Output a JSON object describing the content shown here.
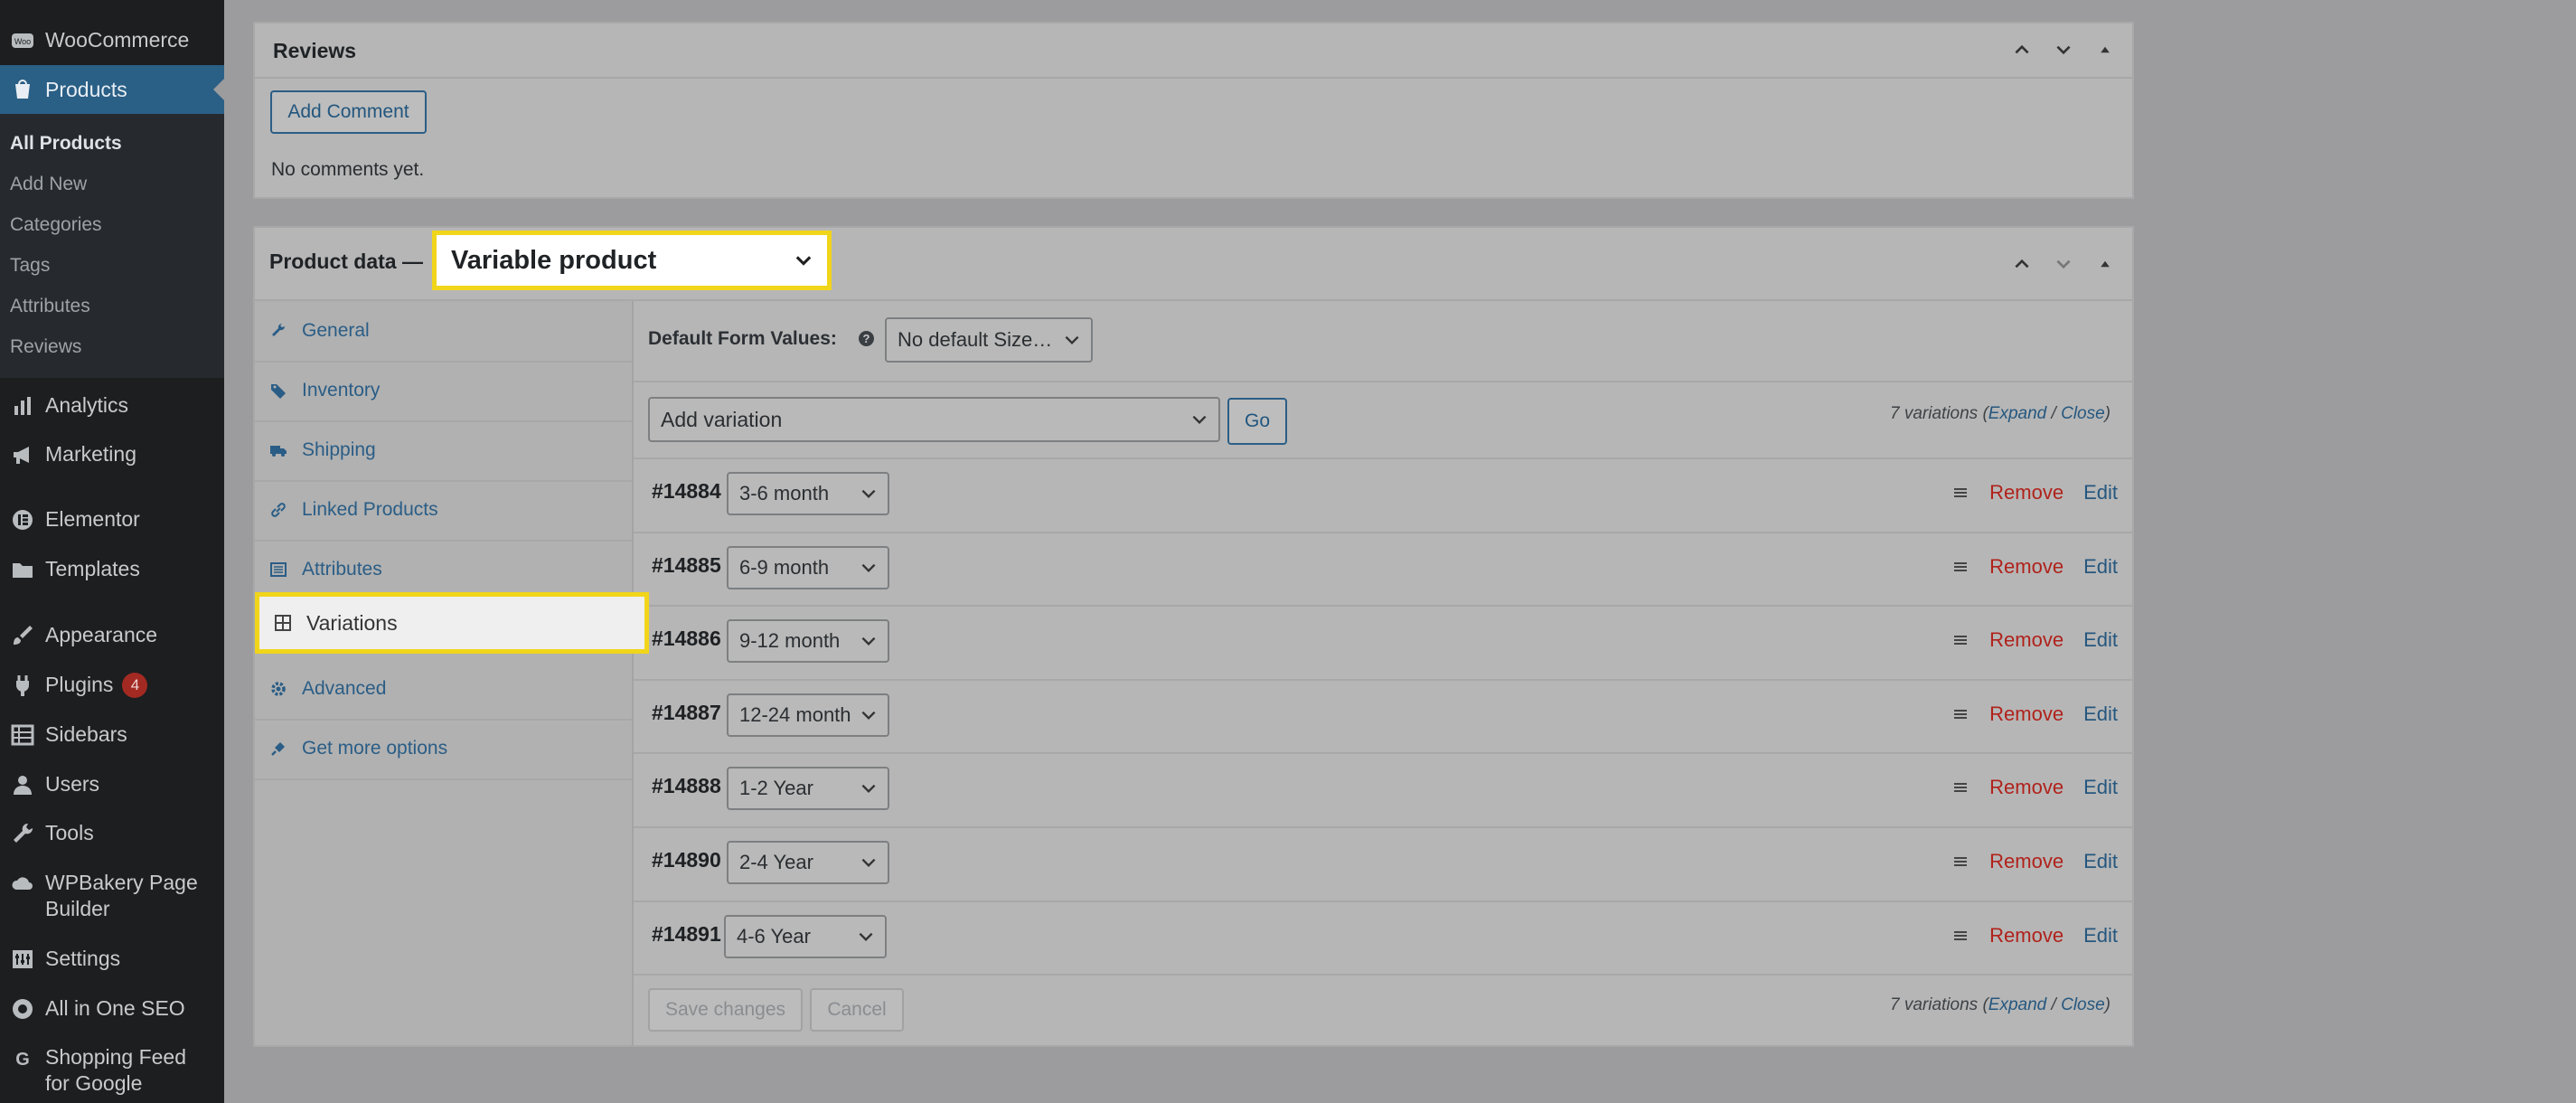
{
  "sidebar": {
    "woocommerce": "WooCommerce",
    "products": "Products",
    "submenu": [
      "All Products",
      "Add New",
      "Categories",
      "Tags",
      "Attributes",
      "Reviews"
    ],
    "analytics": "Analytics",
    "marketing": "Marketing",
    "elementor": "Elementor",
    "templates": "Templates",
    "appearance": "Appearance",
    "plugins": "Plugins",
    "plugins_badge": "4",
    "sidebars": "Sidebars",
    "users": "Users",
    "tools": "Tools",
    "wpbakery_line1": "WPBakery Page",
    "wpbakery_line2": "Builder",
    "settings": "Settings",
    "aioseo": "All in One SEO",
    "shopping_line1": "Shopping Feed",
    "shopping_line2": "for Google"
  },
  "reviews_panel": {
    "title": "Reviews",
    "add_comment": "Add Comment",
    "empty_text": "No comments yet."
  },
  "product_data": {
    "title": "Product data —",
    "product_type": "Variable product",
    "tabs": [
      "General",
      "Inventory",
      "Shipping",
      "Linked Products",
      "Attributes",
      "Variations",
      "Advanced",
      "Get more options"
    ],
    "default_form_label": "Default Form Values:",
    "default_size_value": "No default Size…",
    "add_variation": "Add variation",
    "go_button": "Go",
    "variations_count": "7 variations",
    "expand": "Expand",
    "close": "Close",
    "variations": [
      {
        "id": "#14884",
        "value": "3-6 month"
      },
      {
        "id": "#14885",
        "value": "6-9 month"
      },
      {
        "id": "#14886",
        "value": "9-12 month"
      },
      {
        "id": "#14887",
        "value": "12-24 month"
      },
      {
        "id": "#14888",
        "value": "1-2 Year"
      },
      {
        "id": "#14890",
        "value": "2-4 Year"
      },
      {
        "id": "#14891",
        "value": "4-6 Year"
      }
    ],
    "remove_label": "Remove",
    "edit_label": "Edit",
    "save_changes": "Save changes",
    "cancel": "Cancel"
  },
  "colors": {
    "highlight": "#f1d51a",
    "link": "#25577f",
    "remove": "#b0221b",
    "active_menu": "#2a5f86"
  }
}
